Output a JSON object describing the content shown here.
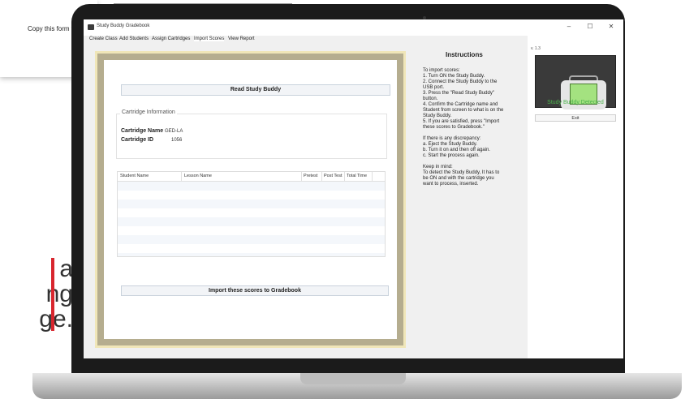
{
  "background": {
    "copy_text": "Copy this form to",
    "big_text_lines": [
      "a",
      "ng",
      "ge."
    ]
  },
  "window": {
    "title": "Study Buddy Gradebook",
    "minimize": "–",
    "maximize": "☐",
    "close": "✕"
  },
  "menu": {
    "items": [
      "Create Class",
      "Add Students",
      "Assign Cartridges",
      "Import Scores",
      "View Report"
    ],
    "active": "Import Scores"
  },
  "main": {
    "read_button": "Read Study Buddy",
    "cartridge_heading": "Cartridge Information",
    "cartridge_name_label": "Cartridge Name",
    "cartridge_name_value": "GED-LA",
    "cartridge_id_label": "Cartridge ID",
    "cartridge_id_value": "1056",
    "table_columns": [
      "Student Name",
      "Lesson Name",
      "Pretest",
      "Post Test",
      "Total Time"
    ],
    "import_button": "Import these scores to Gradebook"
  },
  "instructions": {
    "title": "Instructions",
    "body": "To import scores:\n1. Turn ON the Study Buddy.\n2. Connect the Study Buddy to the USB port.\n3. Press the \"Read Study Buddy\" button.\n4. Confirm the Cartridge name and Student from screen to what is on the Study Buddy.\n5. If you are satisfied, press \"Import these scores to Gradebook.\"\n\nIf there is any discrepancy:\na. Eject the Study Buddy.\nb. Turn it on and then off again.\nc. Start the process again.\n\nKeep in mind:\nTo detect the Study Buddy, It has to be ON and with the cartridge you want to process, inserted."
  },
  "sidebar": {
    "version": "v. 1.3",
    "status": "Study Buddy Detected",
    "exit_label": "Exit"
  },
  "colors": {
    "status_green": "#4db34d",
    "frame_gold": "#b5ad8f",
    "accent_red": "#d8262e"
  }
}
